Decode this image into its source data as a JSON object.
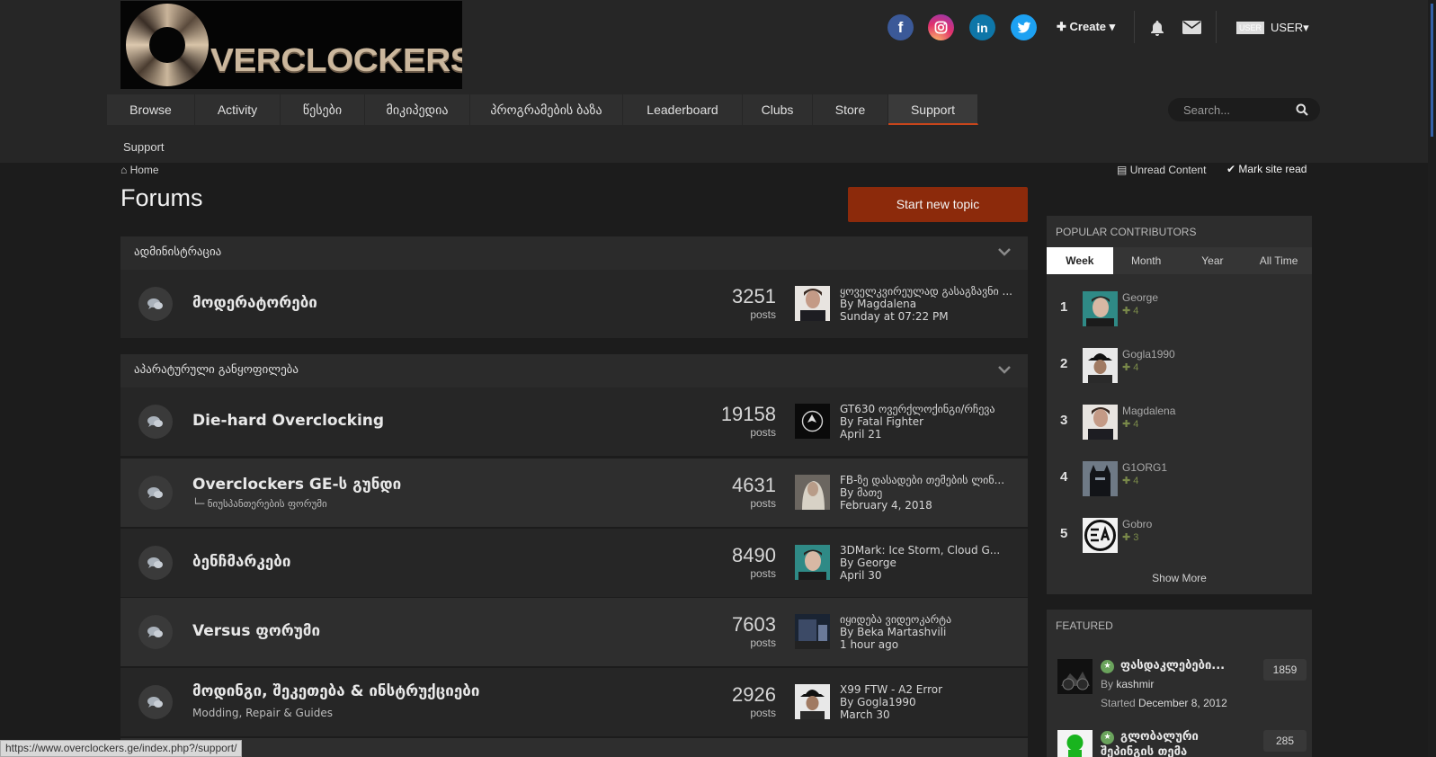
{
  "header": {
    "logo_text": "VERCLOCKERS",
    "create_label": "Create",
    "user_avatar_text": "USER",
    "user_name": "USER"
  },
  "nav": {
    "items": [
      {
        "label": "Browse"
      },
      {
        "label": "Activity"
      },
      {
        "label": "წესები"
      },
      {
        "label": "მიკიპედია"
      },
      {
        "label": "პროგრამების ბაზა"
      },
      {
        "label": "Leaderboard"
      },
      {
        "label": "Clubs"
      },
      {
        "label": "Store"
      },
      {
        "label": "Support"
      }
    ],
    "active": "Support",
    "subnav_label": "Support"
  },
  "search": {
    "placeholder": "Search..."
  },
  "breadcrumb": {
    "home": "Home"
  },
  "page": {
    "title": "Forums",
    "unread_label": "Unread Content",
    "mark_read_label": "Mark site read",
    "new_topic_label": "Start new topic"
  },
  "categories": [
    {
      "title": "ადმინისტრაცია",
      "forums": [
        {
          "title": "მოდერატორები",
          "subtitle": "",
          "count": "3251",
          "posts_label": "posts",
          "last_topic": "ყოველკვირეულად გასაგზავნი ...",
          "last_by": "By Magdalena",
          "last_date": "Sunday at 07:22 PM"
        }
      ]
    },
    {
      "title": "აპარატურული განყოფილება",
      "forums": [
        {
          "title": "Die-hard Overclocking",
          "subtitle": "",
          "count": "19158",
          "posts_label": "posts",
          "last_topic": "GT630 ოვერქლოქინგი/რჩევა",
          "last_by": "By Fatal Fighter",
          "last_date": "April 21"
        },
        {
          "title": "Overclockers GE-ს გუნდი",
          "subtitle": "ნიუსპანთერების ფორუმი",
          "count": "4631",
          "posts_label": "posts",
          "last_topic": "FB-ზე დასადები თემების ლინ...",
          "last_by": "By მათე",
          "last_date": "February 4, 2018"
        },
        {
          "title": "ბენჩმარკები",
          "subtitle": "",
          "count": "8490",
          "posts_label": "posts",
          "last_topic": "3DMark: Ice Storm, Cloud G...",
          "last_by": "By George",
          "last_date": "April 30"
        },
        {
          "title": "Versus ფორუმი",
          "subtitle": "",
          "count": "7603",
          "posts_label": "posts",
          "last_topic": "იყიდება ვიდეოკარტა",
          "last_by": "By Beka Martashvili",
          "last_date": "1 hour ago"
        },
        {
          "title": "მოდინგი, შეკეთება & ინსტრუქციები",
          "subtitle": "Modding, Repair & Guides",
          "count": "2926",
          "posts_label": "posts",
          "last_topic": "X99 FTW - A2 Error",
          "last_by": "By Gogla1990",
          "last_date": "March 30"
        }
      ]
    }
  ],
  "popular_contributors": {
    "title": "POPULAR CONTRIBUTORS",
    "tabs": [
      "Week",
      "Month",
      "Year",
      "All Time"
    ],
    "active_tab": "Week",
    "items": [
      {
        "rank": "1",
        "name": "George",
        "rep": "4"
      },
      {
        "rank": "2",
        "name": "Gogla1990",
        "rep": "4"
      },
      {
        "rank": "3",
        "name": "Magdalena",
        "rep": "4"
      },
      {
        "rank": "4",
        "name": "G1ORG1",
        "rep": "4"
      },
      {
        "rank": "5",
        "name": "Gobro",
        "rep": "3"
      }
    ],
    "show_more": "Show More"
  },
  "featured": {
    "title": "FEATURED",
    "items": [
      {
        "title": "ფასდაკლებები...",
        "by_prefix": "By",
        "by": "kashmir",
        "started_prefix": "Started",
        "started": "December 8, 2012",
        "count": "1859"
      },
      {
        "title": "გლობალური",
        "title2": "შეპინგის თემა",
        "count": "285"
      }
    ]
  },
  "status_url": "https://www.overclockers.ge/index.php?/support/",
  "colors": {
    "accent": "#c8451b",
    "button": "#8c2a0b",
    "facebook": "#3b5998",
    "instagram": "#e1306c",
    "linkedin": "#0e76a8",
    "twitter": "#1da1f2"
  }
}
